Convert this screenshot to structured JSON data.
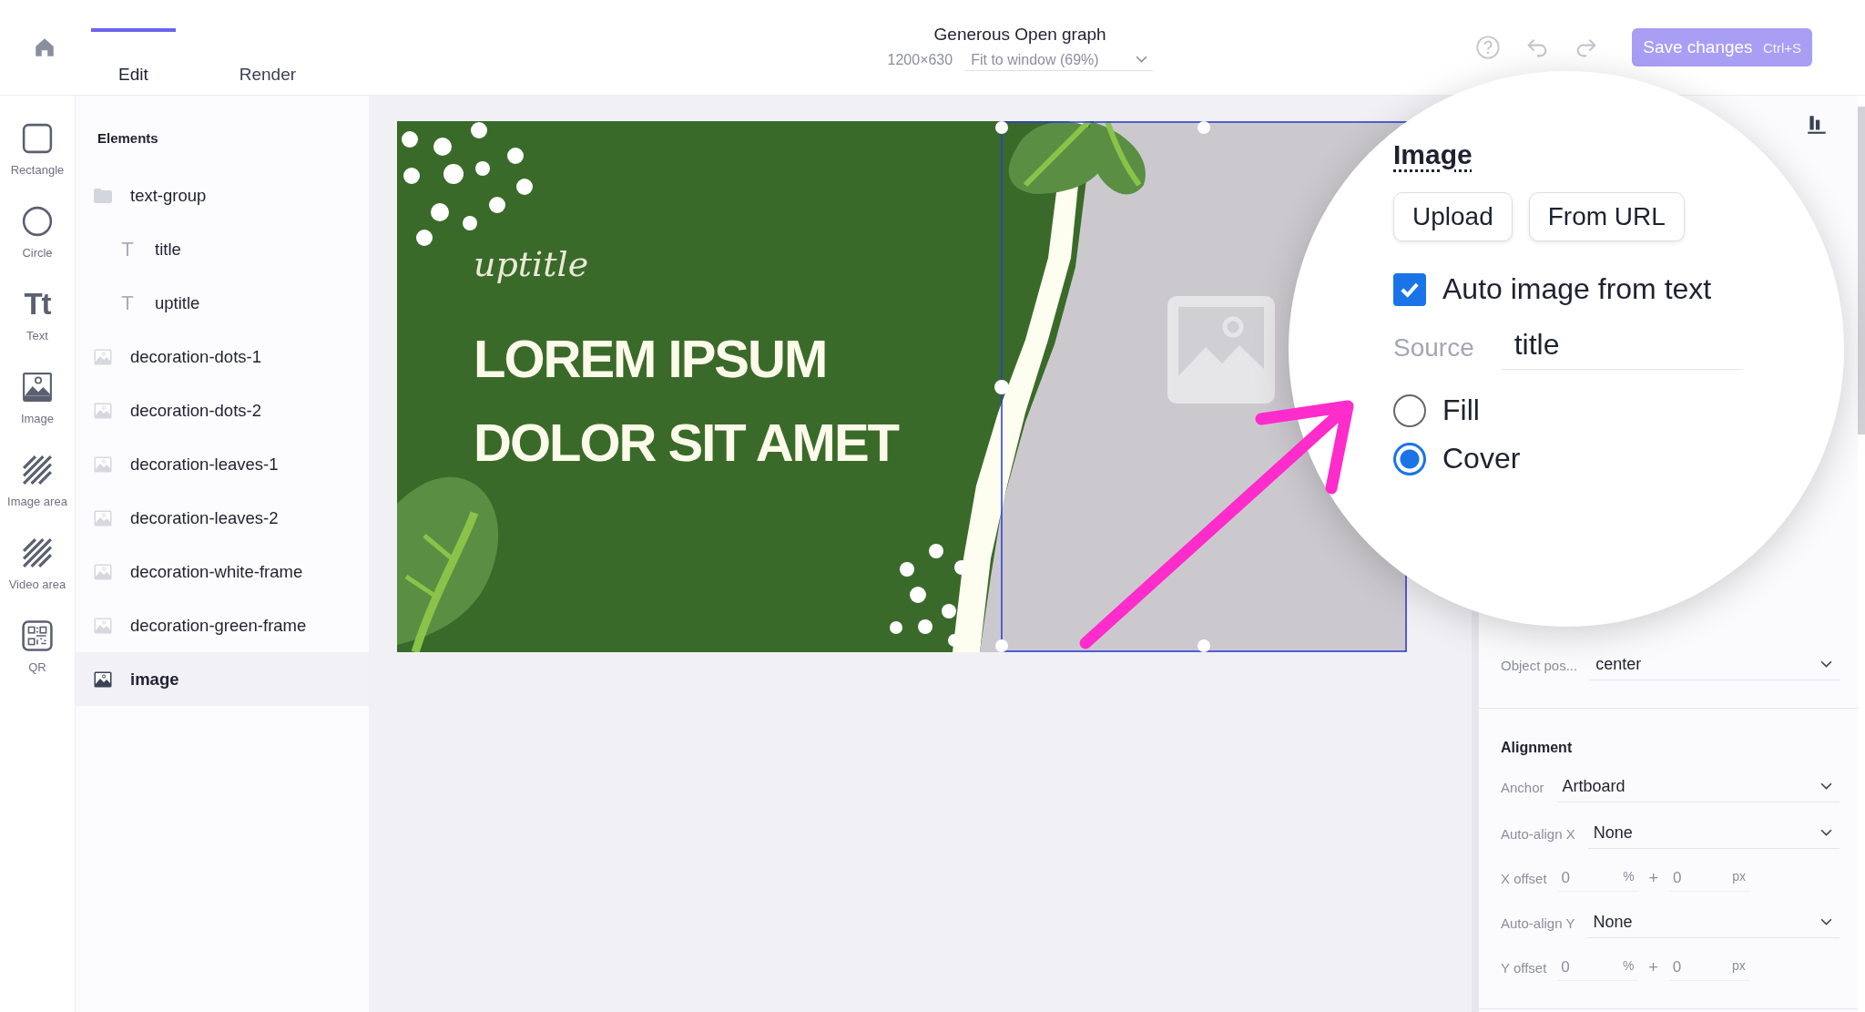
{
  "topbar": {
    "tabs": [
      {
        "label": "Edit",
        "selected": true
      },
      {
        "label": "Render",
        "selected": false
      }
    ],
    "document_title": "Generous Open graph",
    "size": "1200×630",
    "zoom": "Fit to window (69%)",
    "save_button": {
      "label": "Save changes",
      "shortcut": "Ctrl+S"
    }
  },
  "tools": [
    {
      "kind": "rectangle",
      "label": "Rectangle"
    },
    {
      "kind": "circle",
      "label": "Circle"
    },
    {
      "kind": "text",
      "label": "Text",
      "glyph": "Tt"
    },
    {
      "kind": "image",
      "label": "Image"
    },
    {
      "kind": "image-area",
      "label": "Image area"
    },
    {
      "kind": "video-area",
      "label": "Video area"
    },
    {
      "kind": "qr",
      "label": "QR"
    }
  ],
  "elements": {
    "heading": "Elements",
    "items": [
      {
        "kind": "group",
        "name": "text-group",
        "selected": false,
        "children": [
          {
            "kind": "text",
            "glyph": "T",
            "name": "title",
            "selected": false
          },
          {
            "kind": "text",
            "glyph": "T",
            "name": "uptitle",
            "selected": false
          }
        ]
      },
      {
        "kind": "image",
        "name": "decoration-dots-1",
        "selected": false
      },
      {
        "kind": "image",
        "name": "decoration-dots-2",
        "selected": false
      },
      {
        "kind": "image",
        "name": "decoration-leaves-1",
        "selected": false
      },
      {
        "kind": "image",
        "name": "decoration-leaves-2",
        "selected": false
      },
      {
        "kind": "image",
        "name": "decoration-white-frame",
        "selected": false
      },
      {
        "kind": "image",
        "name": "decoration-green-frame",
        "selected": false
      },
      {
        "kind": "image",
        "name": "image",
        "selected": true
      }
    ]
  },
  "artboard": {
    "uptitle": "uptitle",
    "title_lines": [
      "LOREM IPSUM",
      "DOLOR SIT AMET"
    ]
  },
  "image_panel": {
    "heading": "Image",
    "buttons": [
      "Upload",
      "From URL"
    ],
    "auto_image": {
      "label": "Auto image from text",
      "checked": true
    },
    "source": {
      "label": "Source",
      "value": "title"
    },
    "fit_options": [
      {
        "label": "Fill",
        "selected": false
      },
      {
        "label": "Cover",
        "selected": true
      }
    ]
  },
  "object_position": {
    "label": "Object pos...",
    "value": "center"
  },
  "alignment": {
    "heading": "Alignment",
    "rows": [
      {
        "kind": "select",
        "label": "Anchor",
        "value": "Artboard"
      },
      {
        "kind": "select",
        "label": "Auto-align X",
        "value": "None"
      },
      {
        "kind": "offset",
        "label": "X offset",
        "percent": "0",
        "percent_unit": "%",
        "plus": "+",
        "pixels": "0",
        "pixel_unit": "px"
      },
      {
        "kind": "select",
        "label": "Auto-align Y",
        "value": "None"
      },
      {
        "kind": "offset",
        "label": "Y offset",
        "percent": "0",
        "percent_unit": "%",
        "plus": "+",
        "pixels": "0",
        "pixel_unit": "px"
      }
    ]
  }
}
